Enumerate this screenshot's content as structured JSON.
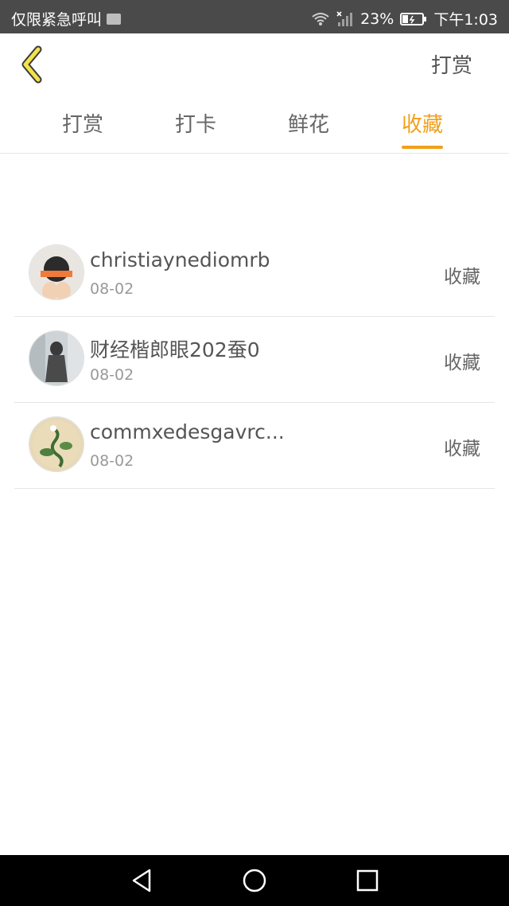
{
  "status_bar": {
    "left_text": "仅限紧急呼叫",
    "battery_percent": "23%",
    "time": "下午1:03"
  },
  "header": {
    "back_icon": "back-chevron-icon",
    "action_label": "打赏",
    "accent_color": "#f0a01c"
  },
  "tabs": [
    {
      "label": "打赏",
      "active": false
    },
    {
      "label": "打卡",
      "active": false
    },
    {
      "label": "鲜花",
      "active": false
    },
    {
      "label": "收藏",
      "active": true
    }
  ],
  "list": {
    "items": [
      {
        "name": "christiaynediomrb",
        "date": "08-02",
        "action": "收藏"
      },
      {
        "name": "财经楷郎眼202蚕0",
        "date": "08-02",
        "action": "收藏"
      },
      {
        "name": "commxedesgavrc...",
        "date": "08-02",
        "action": "收藏"
      }
    ]
  },
  "nav": {
    "back_icon": "triangle-back-icon",
    "home_icon": "circle-home-icon",
    "recent_icon": "square-recent-icon"
  }
}
